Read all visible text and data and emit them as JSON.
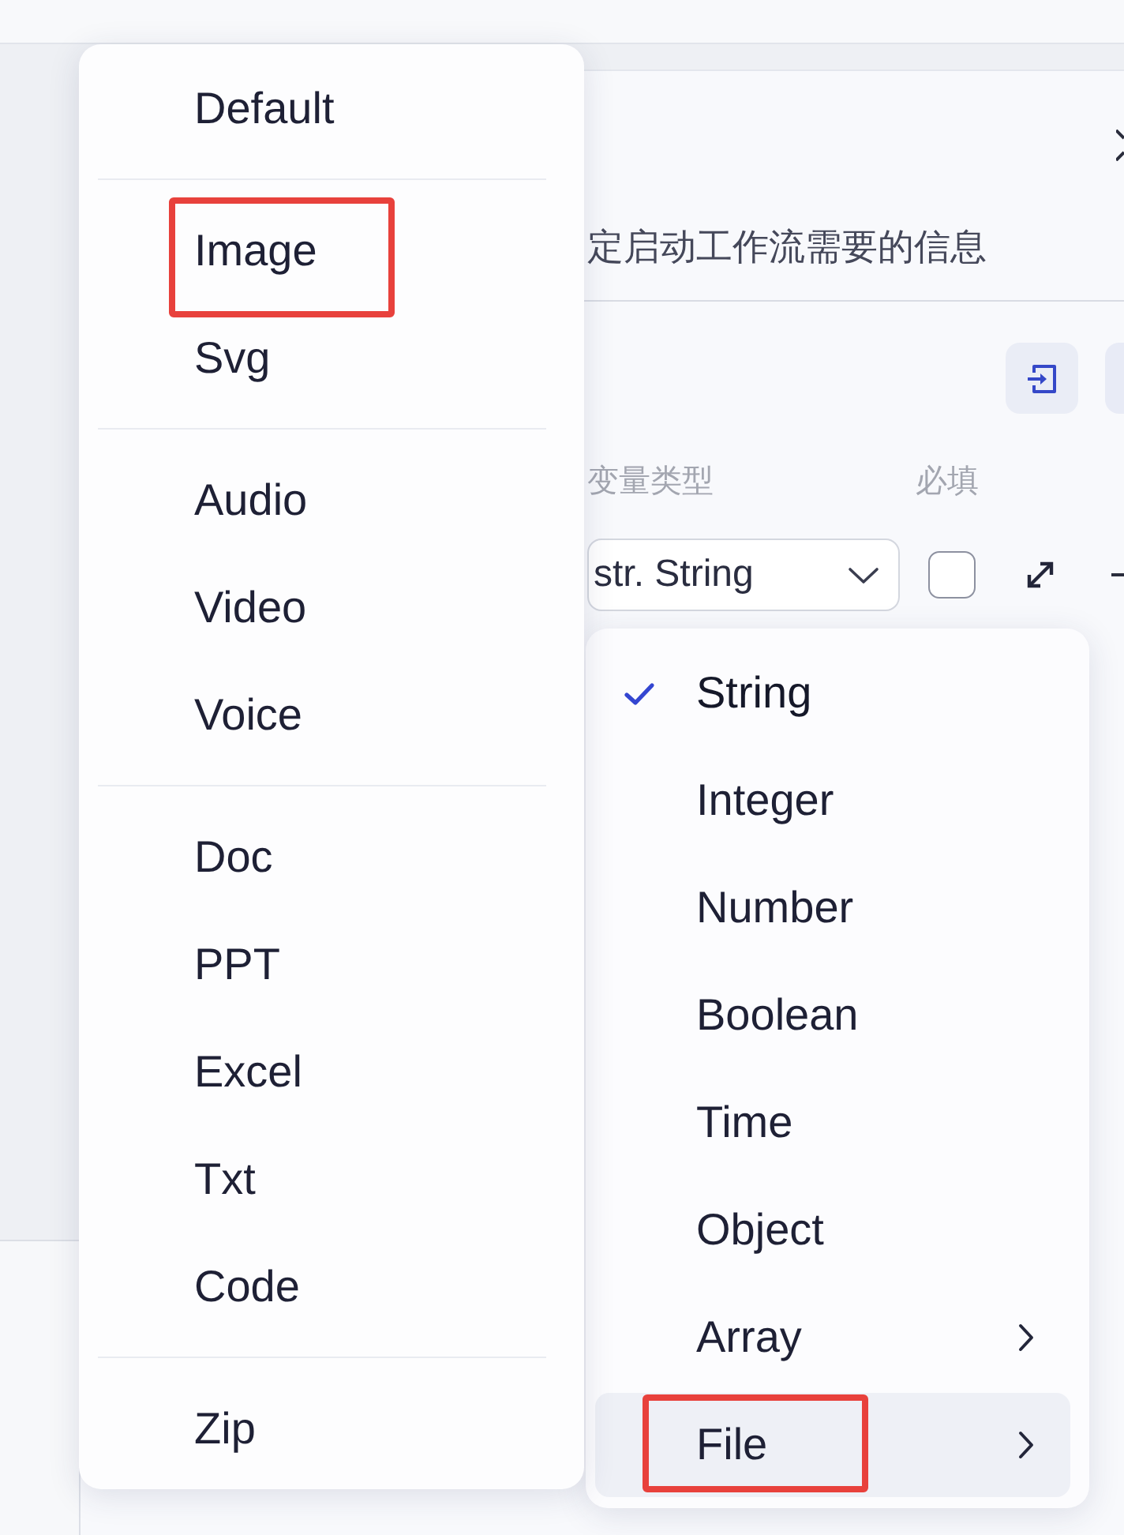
{
  "panel": {
    "description": "定启动工作流需要的信息",
    "columns": [
      {
        "label": "变量类型"
      },
      {
        "label": "必填"
      }
    ],
    "variable": {
      "type_value": "str. String",
      "required": {
        "checked": false
      }
    }
  },
  "file_type_menu": {
    "groups": [
      {
        "items": [
          {
            "label": "Default",
            "annotated": false
          }
        ]
      },
      {
        "items": [
          {
            "label": "Image",
            "annotated": true
          },
          {
            "label": "Svg",
            "annotated": false
          }
        ]
      },
      {
        "items": [
          {
            "label": "Audio",
            "annotated": false
          },
          {
            "label": "Video",
            "annotated": false
          },
          {
            "label": "Voice",
            "annotated": false
          }
        ]
      },
      {
        "items": [
          {
            "label": "Doc",
            "annotated": false
          },
          {
            "label": "PPT",
            "annotated": false
          },
          {
            "label": "Excel",
            "annotated": false
          },
          {
            "label": "Txt",
            "annotated": false
          },
          {
            "label": "Code",
            "annotated": false
          }
        ]
      },
      {
        "items": [
          {
            "label": "Zip",
            "annotated": false
          }
        ]
      }
    ]
  },
  "type_menu": {
    "items": [
      {
        "label": "String",
        "selected": true,
        "hovered": false,
        "has_submenu": false,
        "annotated": false
      },
      {
        "label": "Integer",
        "selected": false,
        "hovered": false,
        "has_submenu": false,
        "annotated": false
      },
      {
        "label": "Number",
        "selected": false,
        "hovered": false,
        "has_submenu": false,
        "annotated": false
      },
      {
        "label": "Boolean",
        "selected": false,
        "hovered": false,
        "has_submenu": false,
        "annotated": false
      },
      {
        "label": "Time",
        "selected": false,
        "hovered": false,
        "has_submenu": false,
        "annotated": false
      },
      {
        "label": "Object",
        "selected": false,
        "hovered": false,
        "has_submenu": false,
        "annotated": false
      },
      {
        "label": "Array",
        "selected": false,
        "hovered": false,
        "has_submenu": true,
        "annotated": false
      },
      {
        "label": "File",
        "selected": false,
        "hovered": true,
        "has_submenu": true,
        "annotated": true
      }
    ]
  }
}
